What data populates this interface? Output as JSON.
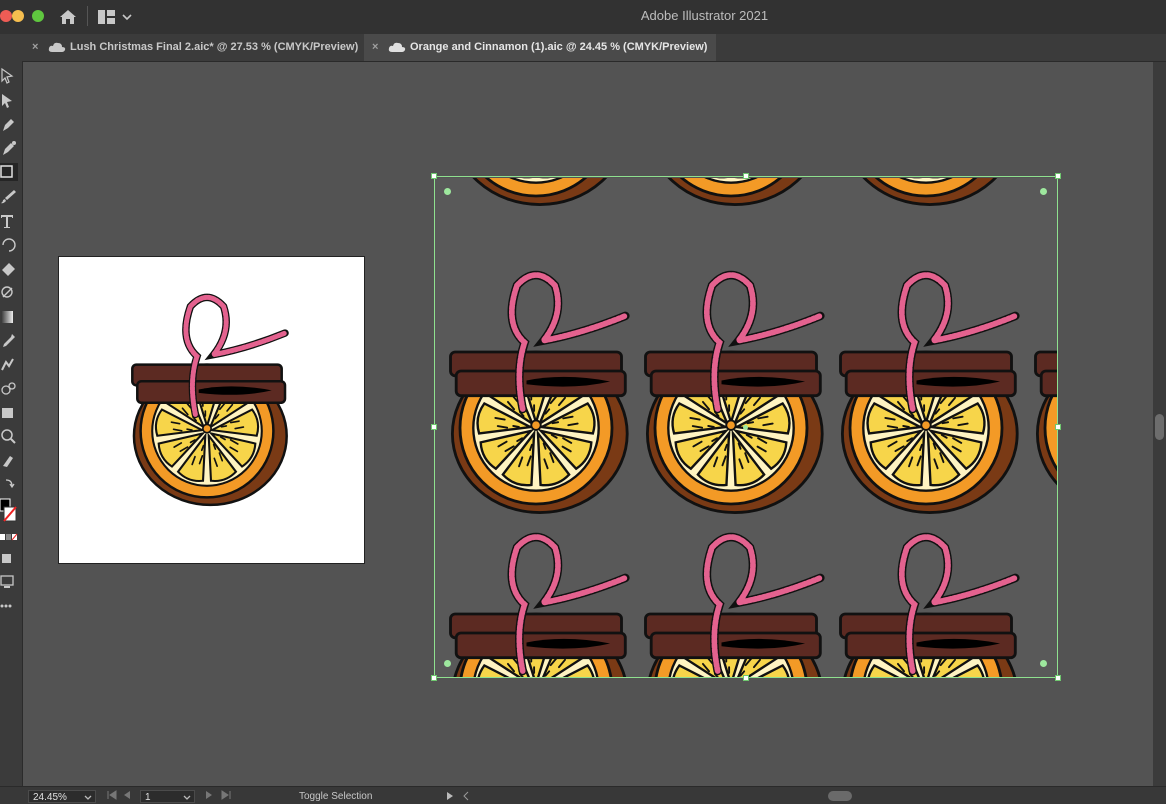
{
  "window": {
    "title": "Adobe Illustrator 2021"
  },
  "titlebar": {
    "home_icon": "home-icon",
    "workspace_icon": "workspace-switcher-icon"
  },
  "tabs": [
    {
      "close": "×",
      "label": "Lush Christmas Final 2.aic* @ 27.53 % (CMYK/Preview)",
      "active": false
    },
    {
      "close": "×",
      "label": "Orange and Cinnamon (1).aic @ 24.45 % (CMYK/Preview)",
      "active": true
    }
  ],
  "tools": [
    "selection-tool-icon",
    "direct-selection-tool-icon",
    "pen-tool-icon",
    "curvature-tool-icon",
    "rectangle-tool-icon",
    "paintbrush-tool-icon",
    "type-tool-icon",
    "rotate-tool-icon",
    "eraser-tool-icon",
    "scale-tool-icon",
    "gradient-tool-icon",
    "eyedropper-tool-icon",
    "blend-tool-icon",
    "symbol-sprayer-tool-icon",
    "artboard-tool-icon",
    "zoom-tool-icon",
    "swatch-swap-icon",
    "fill-stroke-icon",
    "color-mode-icon",
    "drawing-mode-icon",
    "screen-mode-icon",
    "more-tools-icon"
  ],
  "colors": {
    "orange": "#f39a26",
    "peel": "#8e4a1a",
    "cinnamon": "#5c2a22",
    "string": "#e4628f",
    "segment": "#f7d54a",
    "selection": "#8fe18f"
  },
  "status": {
    "zoom": "24.45%",
    "artboard": "1",
    "tool_text": "Toggle Selection"
  }
}
